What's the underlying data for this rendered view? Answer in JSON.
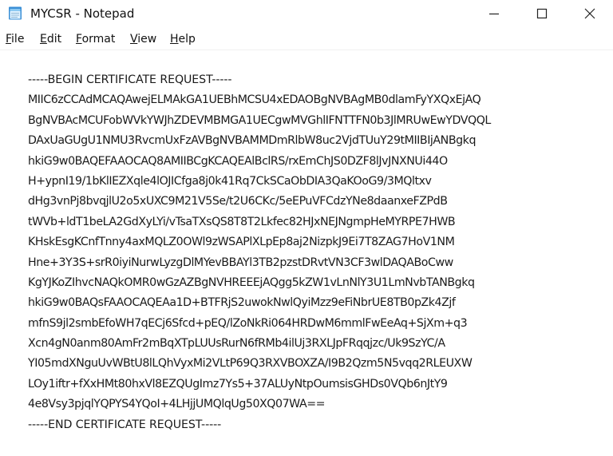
{
  "window": {
    "title": "MYCSR - Notepad"
  },
  "icons": {
    "app": "notepad-icon",
    "minimize": "minimize-icon",
    "maximize": "maximize-icon",
    "close": "close-icon"
  },
  "menu": {
    "items": [
      "File",
      "Edit",
      "Format",
      "View",
      "Help"
    ]
  },
  "editor": {
    "lines": [
      "-----BEGIN CERTIFICATE REQUEST-----",
      "MIIC6zCCAdMCAQAwejELMAkGA1UEBhMCSU4xEDAOBgNVBAgMB0dlamFyYXQxEjAQ",
      "BgNVBAcMCUFobWVkYWJhZDEVMBMGA1UECgwMVGhlIFNTTFN0b3JlMRUwEwYDVQQL",
      "DAxUaGUgU1NMU3RvcmUxFzAVBgNVBAMMDmRlbW8uc2VjdTUuY29tMIIBIjANBgkq",
      "hkiG9w0BAQEFAAOCAQ8AMIIBCgKCAQEAlBclRS/rxEmChJS0DZF8lJvJNXNUi44O",
      "H+ypnI19/1bKlIEZXqle4lOJICfga8j0k41Rq7CkSCaObDIA3QaKOoG9/3MQltxv",
      "dHg3vnPj8bvqjlU2o5xUXC9M21V5Se/t2U6CKc/5eEPuVFCdzYNe8daanxeFZPdB",
      "tWVb+ldT1beLA2GdXyLYi/vTsaTXsQS8T8T2Lkfec82HJxNEJNgmpHeMYRPE7HWB",
      "KHskEsgKCnfTnny4axMQLZ0OWl9zWSAPlXLpEp8aj2NizpkJ9Ei7T8ZAG7HoV1NM",
      "Hne+3Y3S+srR0iyiNurwLyzgDlMYevBBAYl3TB2pzstDRvtVN3CF3wlDAQABoCww",
      "KgYJKoZIhvcNAQkOMR0wGzAZBgNVHREEEjAQgg5kZW1vLnNlY3U1LmNvbTANBgkq",
      "hkiG9w0BAQsFAAOCAQEAa1D+BTFRjS2uwokNwlQyiMzz9eFiNbrUE8TB0pZk4Zjf",
      "mfnS9jl2smbEfoWH7qECj6Sfcd+pEQ/lZoNkRi064HRDwM6mmlFwEeAq+SjXm+q3",
      "Xcn4gN0anm80AmFr2mBqXTpLUUsRurN6fRMb4ilUj3RXLJpFRqqjzc/Uk9SzYC/A",
      "YI05mdXNguUvWBtU8lLQhVyxMi2VLtP69Q3RXVBOXZA/I9B2Qzm5N5vqq2RLEUXW",
      "LOy1iftr+fXxHMt80hxVl8EZQUgImz7Ys5+37ALUyNtpOumsisGHDs0VQb6nJtY9",
      "4e8Vsy3pjqlYQPYS4YQoI+4LHjjUMQlqUg50XQ07WA==",
      "-----END CERTIFICATE REQUEST-----"
    ]
  }
}
